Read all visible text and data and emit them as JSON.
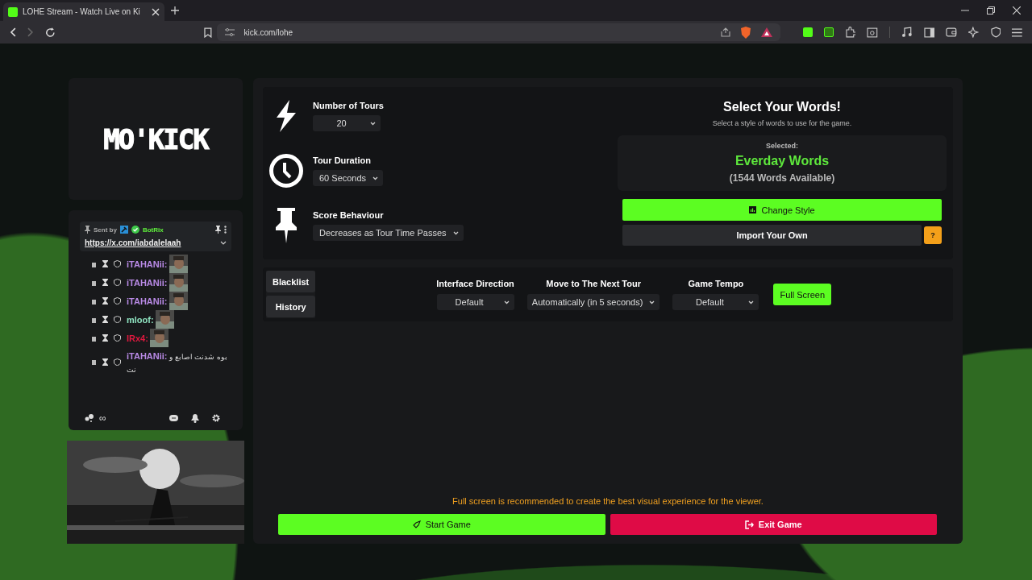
{
  "browser": {
    "tab_title": "LOHE Stream - Watch Live on Ki",
    "url": "kick.com/lohe"
  },
  "logo": "MO'KICK",
  "chat": {
    "pinned": {
      "label": "Sent by",
      "bot": "BotRix",
      "link": "https://x.com/iabdalelaah"
    },
    "messages": [
      {
        "user": "iTAHANii:",
        "color": "#b98ae6",
        "kind": "emote"
      },
      {
        "user": "iTAHANii:",
        "color": "#b98ae6",
        "kind": "emote"
      },
      {
        "user": "iTAHANii:",
        "color": "#b98ae6",
        "kind": "emote"
      },
      {
        "user": "mloof:",
        "color": "#8fe3c0",
        "kind": "emote"
      },
      {
        "user": "IRx4:",
        "color": "#e0193f",
        "kind": "emote"
      },
      {
        "user": "iTAHANii:",
        "color": "#b98ae6",
        "kind": "text",
        "text": "بوه شدنت اصابع و نت"
      }
    ],
    "footer_count": "∞"
  },
  "settings": [
    {
      "kind": "bolt",
      "label": "Number of Tours",
      "value": "20"
    },
    {
      "kind": "clock",
      "label": "Tour Duration",
      "value": "60 Seconds"
    },
    {
      "kind": "pin",
      "label": "Score Behaviour",
      "value": "Decreases as Tour Time Passes"
    }
  ],
  "words": {
    "title": "Select Your Words!",
    "subtitle": "Select a style of words to use for the game.",
    "selected_label": "Selected:",
    "selected_name": "Everday Words",
    "count": "(1544 Words Available)",
    "change_style": "Change Style",
    "import": "Import Your Own",
    "help": "?"
  },
  "side_buttons": [
    "Blacklist",
    "History"
  ],
  "options": [
    {
      "label": "Interface Direction",
      "value": "Default"
    },
    {
      "label": "Move to The Next Tour",
      "value": "Automatically (in 5 seconds)"
    },
    {
      "label": "Game Tempo",
      "value": "Default"
    }
  ],
  "full_screen": "Full Screen",
  "note": "Full screen is recommended to create the best visual experience for the viewer.",
  "start": "Start Game",
  "exit": "Exit Game"
}
